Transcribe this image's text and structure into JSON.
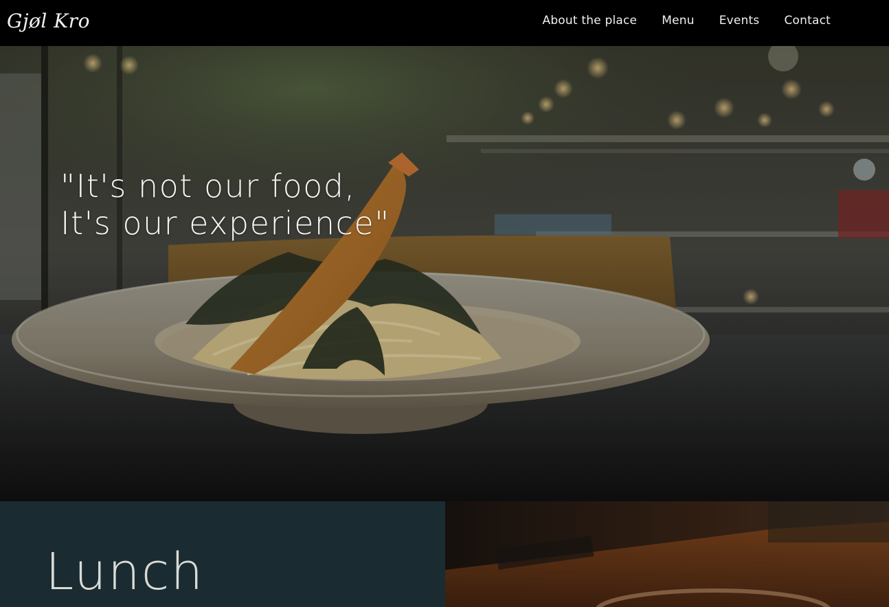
{
  "brand": {
    "logo_text": "Gjøl Kro"
  },
  "nav": {
    "items": [
      {
        "label": "About the place"
      },
      {
        "label": "Menu"
      },
      {
        "label": "Events"
      },
      {
        "label": "Contact"
      }
    ]
  },
  "hero": {
    "quote_line1": "\"It's not our food,",
    "quote_line2": "It's our experience\""
  },
  "sections": {
    "lunch_title": "Lunch"
  },
  "colors": {
    "header_bg": "#000000",
    "lunch_panel_bg": "#1b2b32",
    "text_light": "#f0f0f0"
  }
}
